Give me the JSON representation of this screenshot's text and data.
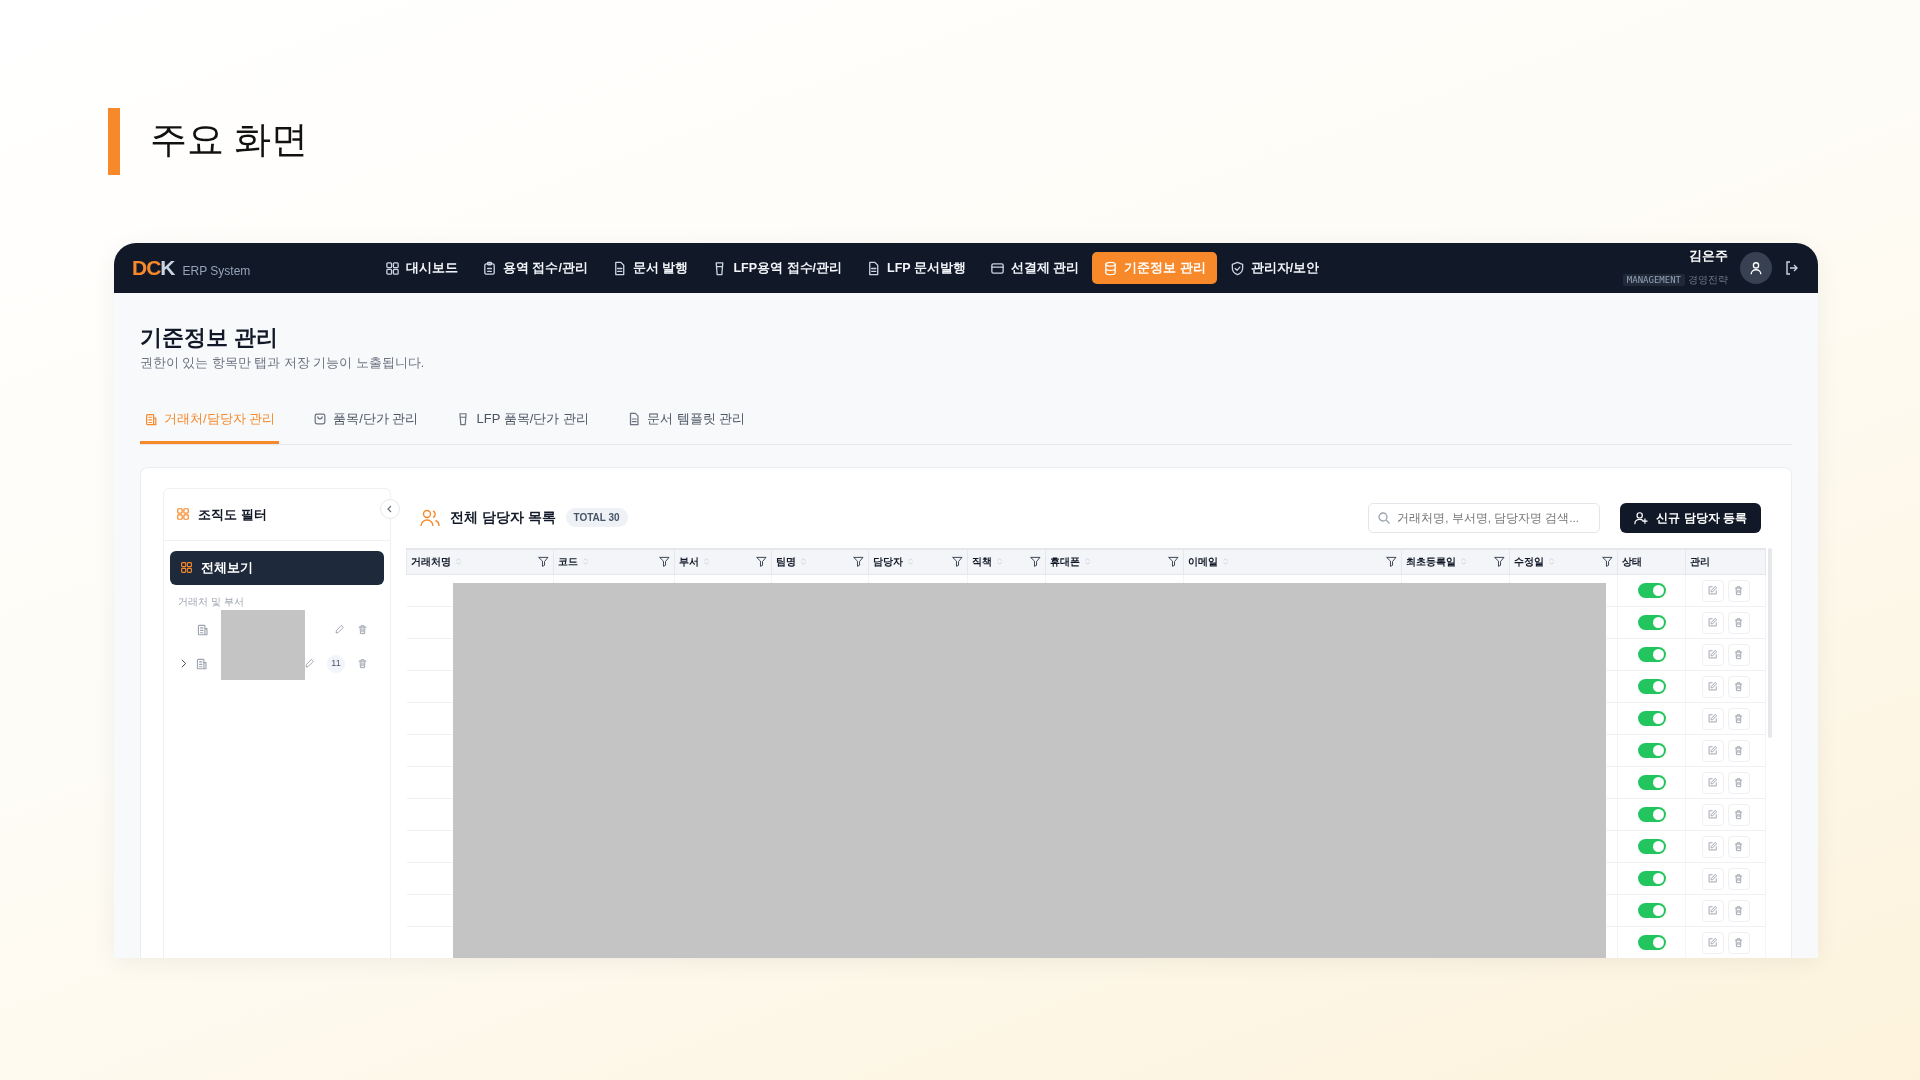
{
  "slide": {
    "title": "주요 화면"
  },
  "navbar": {
    "logo_accent": "DC",
    "logo_rest": "K",
    "logo_sub": "ERP System",
    "menu": [
      {
        "label": "대시보드",
        "selected": false
      },
      {
        "label": "용역 접수/관리",
        "selected": false
      },
      {
        "label": "문서 발행",
        "selected": false
      },
      {
        "label": "LFP용역 접수/관리",
        "selected": false
      },
      {
        "label": "LFP 문서발행",
        "selected": false
      },
      {
        "label": "선결제 관리",
        "selected": false
      },
      {
        "label": "기준정보 관리",
        "selected": true
      },
      {
        "label": "관리자/보안",
        "selected": false
      }
    ],
    "user": {
      "name": "김은주",
      "role": "MANAGEMENT",
      "dept": "경영전략"
    }
  },
  "page": {
    "title": "기준정보 관리",
    "subtitle": "권한이 있는 항목만 탭과 저장 기능이 노출됩니다."
  },
  "tabs": [
    {
      "label": "거래처/담당자 관리",
      "selected": true
    },
    {
      "label": "품목/단가 관리",
      "selected": false
    },
    {
      "label": "LFP 품목/단가 관리",
      "selected": false
    },
    {
      "label": "문서 템플릿 관리",
      "selected": false
    }
  ],
  "sidebar": {
    "title": "조직도 필터",
    "all_button": {
      "label": "전체보기",
      "selected": true
    },
    "section_label": "거래처 및 부서",
    "items": [
      {
        "kind": "leaf"
      },
      {
        "kind": "branch",
        "expanded": false,
        "count": "11"
      }
    ]
  },
  "list": {
    "title": "전체 담당자 목록",
    "total": "TOTAL 30",
    "search": {
      "placeholder": "거래처명, 부서명, 담당자명 검색..."
    },
    "add_button": "신규 담당자 등록",
    "columns": [
      {
        "label": "거래처명",
        "sortable": true,
        "filter": true
      },
      {
        "label": "코드",
        "sortable": true,
        "filter": true
      },
      {
        "label": "부서",
        "sortable": true,
        "filter": true
      },
      {
        "label": "팀명",
        "sortable": true,
        "filter": true
      },
      {
        "label": "담당자",
        "sortable": true,
        "filter": true
      },
      {
        "label": "직책",
        "sortable": true,
        "filter": true
      },
      {
        "label": "휴대폰",
        "sortable": true,
        "filter": true
      },
      {
        "label": "이메일",
        "sortable": true,
        "filter": true
      },
      {
        "label": "최초등록일",
        "sortable": true,
        "filter": true
      },
      {
        "label": "수정일",
        "sortable": true,
        "filter": true
      },
      {
        "label": "상태",
        "sortable": false,
        "filter": false
      },
      {
        "label": "관리",
        "sortable": false,
        "filter": false
      }
    ],
    "rows": [
      {
        "active": true
      },
      {
        "active": true
      },
      {
        "active": true
      },
      {
        "active": true
      },
      {
        "active": true
      },
      {
        "active": true
      },
      {
        "active": true
      },
      {
        "active": true
      },
      {
        "active": true
      },
      {
        "active": true
      },
      {
        "active": true
      },
      {
        "active": true
      }
    ]
  }
}
